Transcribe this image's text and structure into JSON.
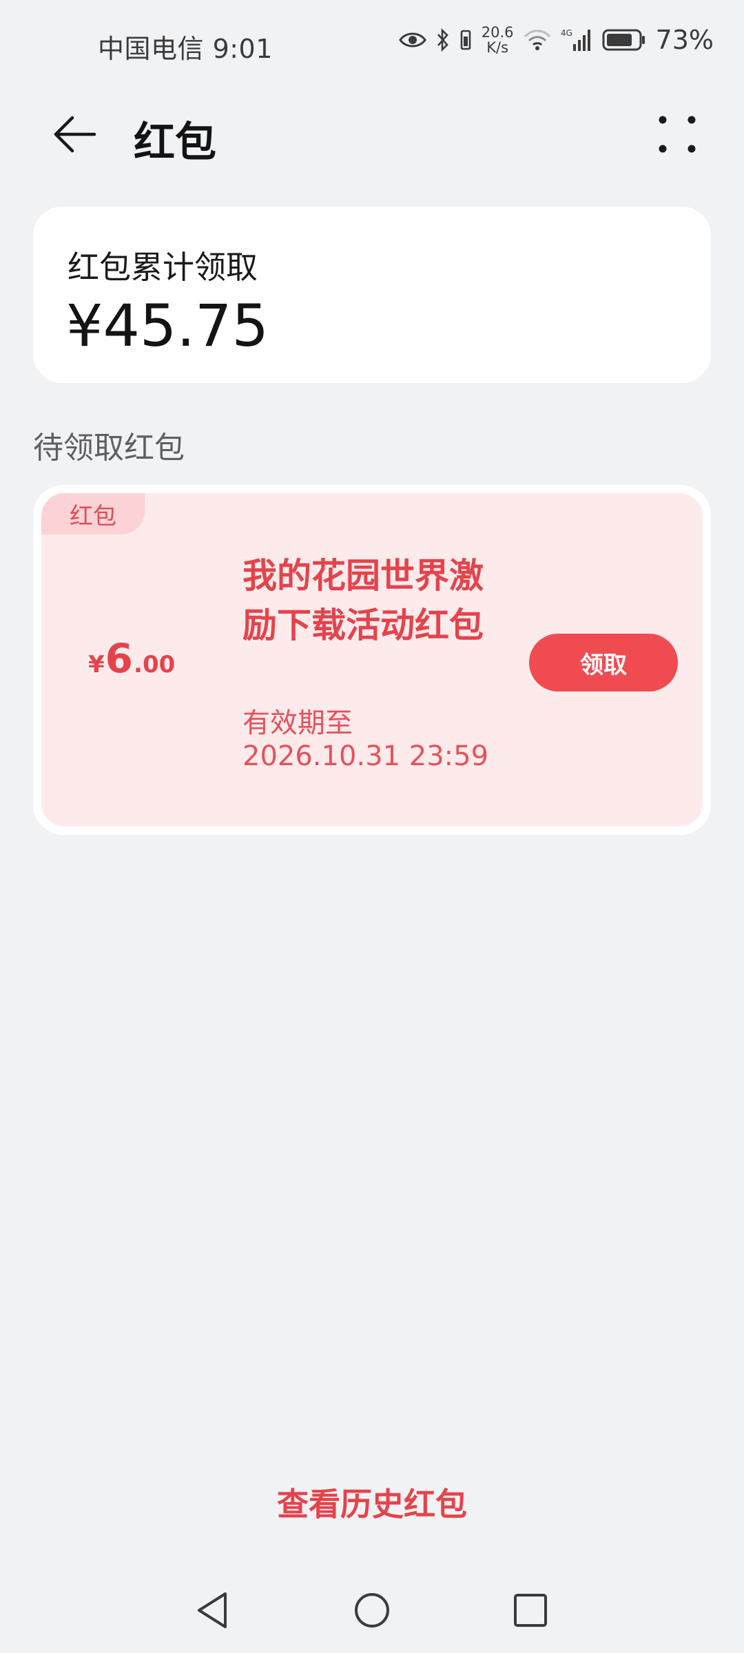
{
  "status_bar": {
    "carrier_time": "中国电信 9:01",
    "net_speed_value": "20.6",
    "net_speed_unit": "K/s",
    "network_type": "4G",
    "battery": "73%",
    "battery_level": 0.73,
    "icons": [
      "eye-icon",
      "bluetooth-icon",
      "vibrate-icon",
      "wifi-icon",
      "signal-icon",
      "battery-icon"
    ]
  },
  "header": {
    "title": "红包",
    "back_icon": "back-arrow-icon",
    "more_icon": "more-dots-icon"
  },
  "summary": {
    "label": "红包累计领取",
    "amount": "¥45.75"
  },
  "section": {
    "title": "待领取红包"
  },
  "packet": {
    "tag": "红包",
    "currency": "¥",
    "amount_int": "6",
    "amount_dec": ".00",
    "title": "我的花园世界激励下载活动红包",
    "expiry": "有效期至 2026.10.31 23:59",
    "claim_label": "领取"
  },
  "footer": {
    "history_link": "查看历史红包"
  },
  "colors": {
    "accent": "#e5434b",
    "button": "#f14b52",
    "packet_bg": "#fdebec",
    "page_bg": "#f1f2f4"
  },
  "nav_bar": {
    "icons": [
      "nav-back-icon",
      "nav-home-icon",
      "nav-recents-icon"
    ]
  }
}
